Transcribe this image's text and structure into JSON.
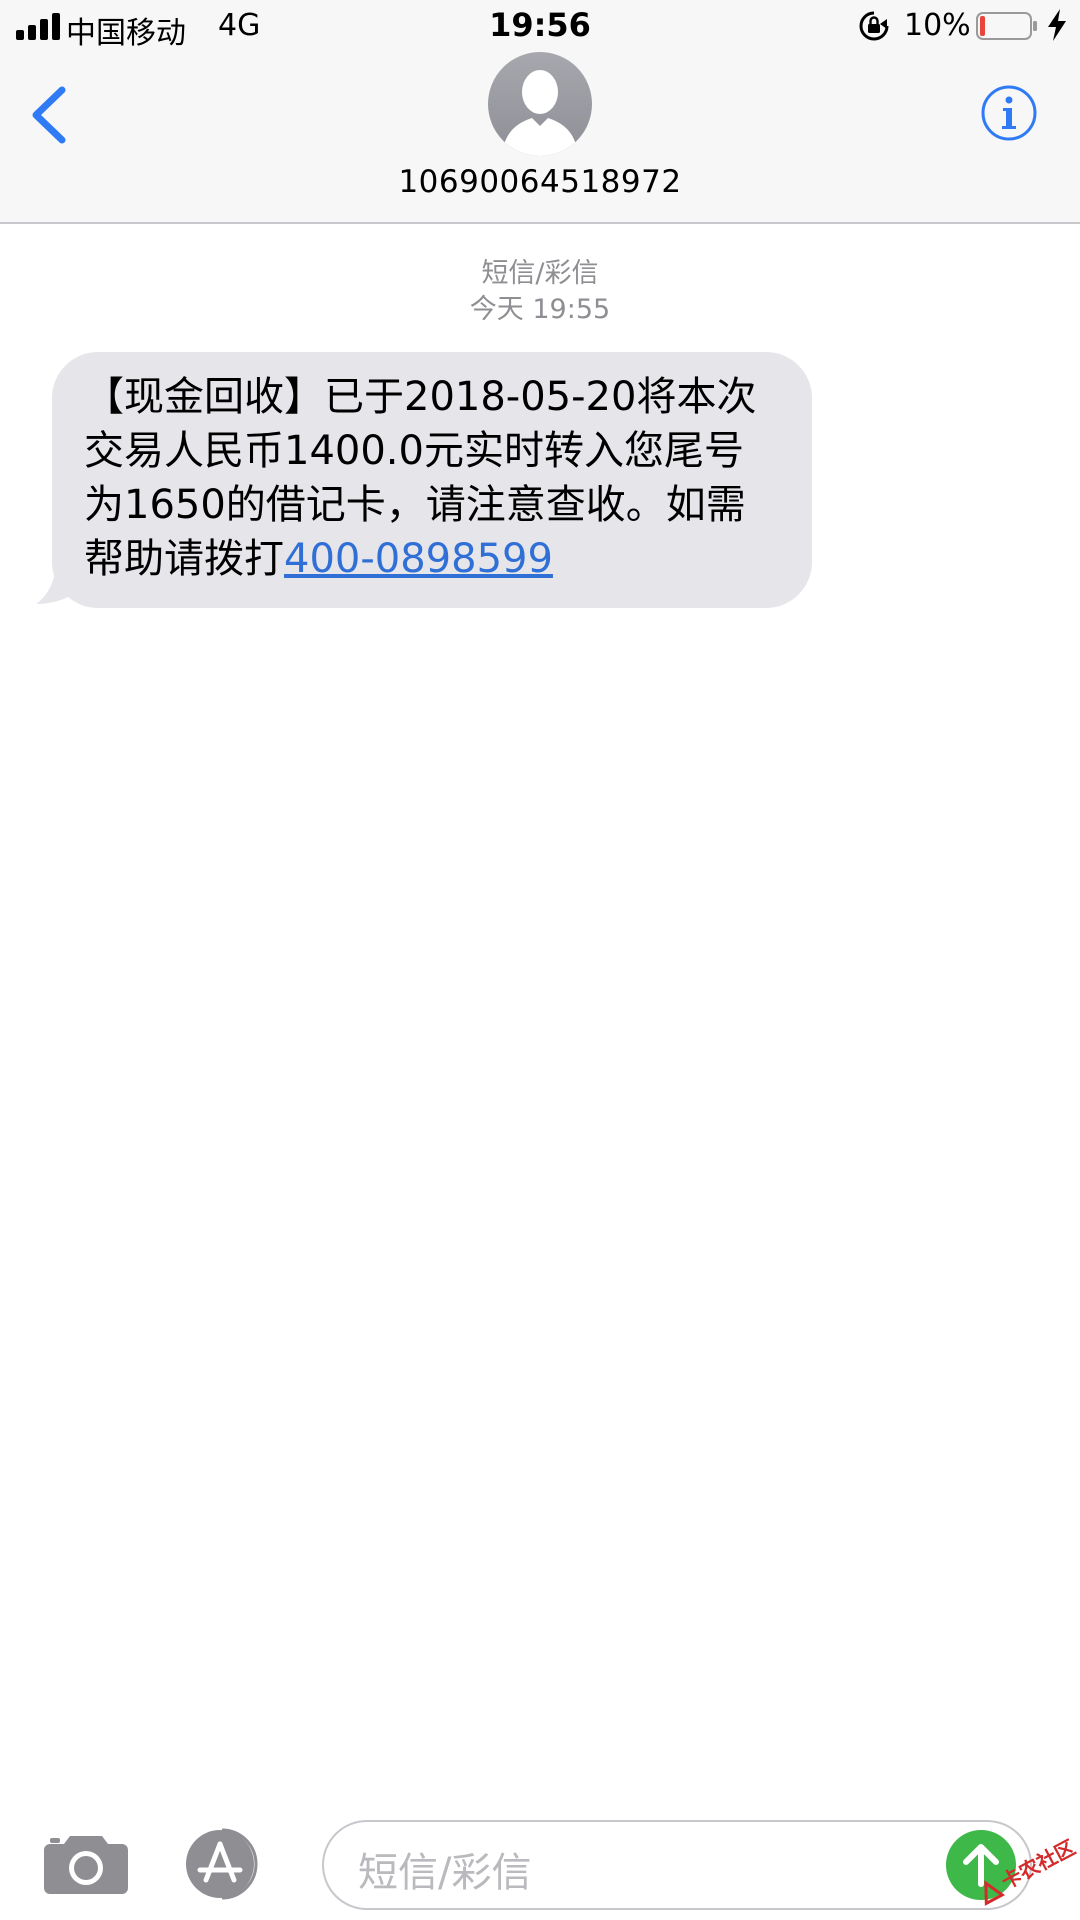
{
  "status_bar": {
    "carrier": "中国移动",
    "network": "4G",
    "time": "19:56",
    "battery_percent": "10%",
    "battery_level": 0.1,
    "battery_color": "#e8453c",
    "icons": [
      "signal-icon",
      "rotation-lock-icon",
      "battery-icon",
      "charging-bolt-icon"
    ]
  },
  "header": {
    "contact_number": "10690064518972",
    "back_icon": "chevron-left-icon",
    "info_icon": "info-icon",
    "accent_color": "#2f7bf6"
  },
  "thread": {
    "service_label": "短信/彩信",
    "timestamp": "今天 19:55"
  },
  "message": {
    "text": "【现金回收】已于2018-05-20将本次交易人民币1400.0元实时转入您尾号为1650的借记卡，请注意查收。如需帮助请拨打",
    "phone_link": "400-0898599",
    "bubble_color": "#e5e5ea",
    "link_color": "#2f6fd6"
  },
  "composer": {
    "placeholder": "短信/彩信",
    "camera_icon": "camera-icon",
    "appstore_icon": "app-store-icon",
    "send_icon": "arrow-up-icon",
    "send_color": "#3fb84a"
  },
  "watermark": {
    "text": "卡农社区"
  }
}
